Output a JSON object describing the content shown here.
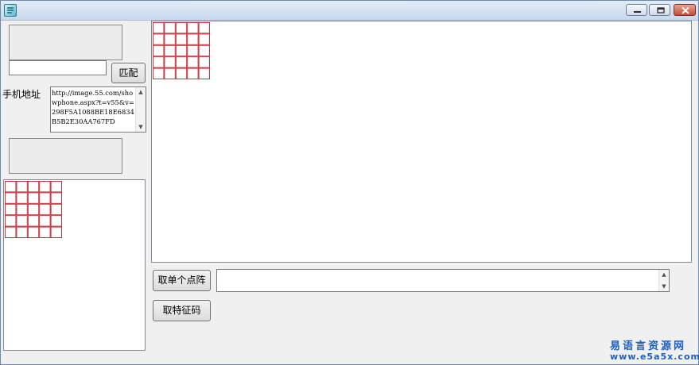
{
  "window": {
    "title": "",
    "controls": {
      "minimize": "minimize-icon",
      "maximize": "maximize-icon",
      "close": "close-icon"
    }
  },
  "left": {
    "match_input": {
      "value": "",
      "placeholder": ""
    },
    "match_button_label": "匹配",
    "phone_address_label": "手机地址",
    "phone_address_value": "http://image.55.com/showphone.aspx?t=v55&v=298F5A1088BE18E6834B5B2E30AA767FD",
    "grid_small": {
      "rows": 5,
      "cols": 5,
      "color": "#c8323c"
    }
  },
  "main": {
    "grid_large": {
      "rows": 5,
      "cols": 5,
      "color": "#c8323c"
    },
    "take_single_matrix_label": "取单个点阵",
    "take_signature_label": "取特征码",
    "result_value": ""
  },
  "watermark": {
    "name": "易语言资源网",
    "url": "www.e5a5x.com",
    "color": "#1c5fc5"
  }
}
